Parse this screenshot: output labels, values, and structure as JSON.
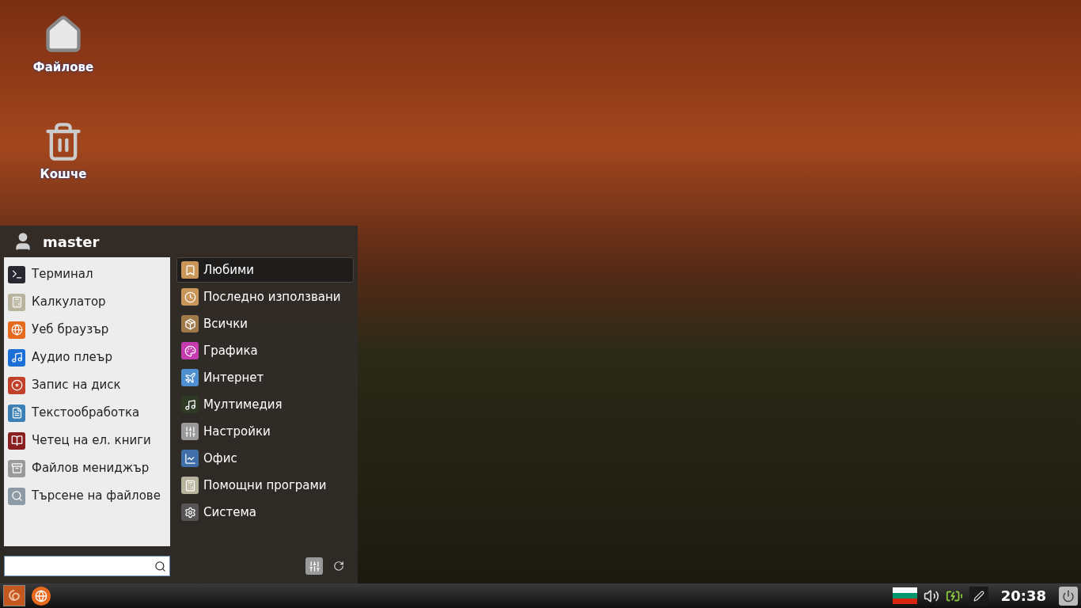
{
  "desktop": {
    "icons": [
      {
        "label": "Файлове",
        "kind": "home"
      },
      {
        "label": "Кошче",
        "kind": "trash"
      }
    ]
  },
  "menu": {
    "user": "master",
    "favorites": [
      {
        "label": "Терминал",
        "kind": "terminal"
      },
      {
        "label": "Калкулатор",
        "kind": "calculator"
      },
      {
        "label": "Уеб браузър",
        "kind": "browser"
      },
      {
        "label": "Аудио плеър",
        "kind": "audio"
      },
      {
        "label": "Запис на диск",
        "kind": "disc"
      },
      {
        "label": "Текстообработка",
        "kind": "document"
      },
      {
        "label": "Четец на ел. книги",
        "kind": "book"
      },
      {
        "label": "Файлов мениджър",
        "kind": "cabinet"
      },
      {
        "label": "Търсене на файлове",
        "kind": "search"
      }
    ],
    "categories": [
      {
        "label": "Любими",
        "kind": "bookmark",
        "selected": true
      },
      {
        "label": "Последно използвани",
        "kind": "recent",
        "selected": false
      },
      {
        "label": "Всички",
        "kind": "package",
        "selected": false
      },
      {
        "label": "Графика",
        "kind": "graphics",
        "selected": false
      },
      {
        "label": "Интернет",
        "kind": "internet",
        "selected": false
      },
      {
        "label": "Мултимедия",
        "kind": "music",
        "selected": false
      },
      {
        "label": "Настройки",
        "kind": "sliders",
        "selected": false
      },
      {
        "label": "Офис",
        "kind": "chart",
        "selected": false
      },
      {
        "label": "Помощни програми",
        "kind": "calculator",
        "selected": false
      },
      {
        "label": "Система",
        "kind": "gear",
        "selected": false
      }
    ]
  },
  "taskbar": {
    "clock": "20:38"
  }
}
